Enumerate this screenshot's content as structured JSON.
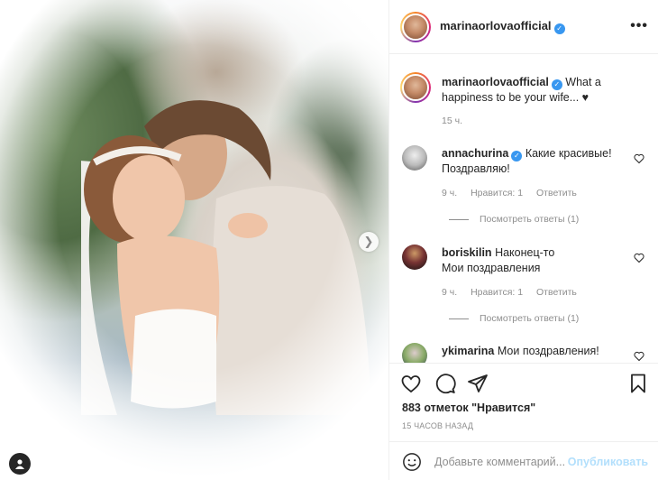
{
  "post": {
    "username": "marinaorlovaofficial",
    "more_label": "•••"
  },
  "caption": {
    "username": "marinaorlovaofficial",
    "text": "What a happiness to be your wife... ♥",
    "time": "15 ч."
  },
  "comments": [
    {
      "username": "annachurina",
      "verified": true,
      "line1": "Какие красивые!",
      "line2": "Поздравляю! ",
      "time": "9 ч.",
      "likes": "Нравится: 1",
      "reply": "Ответить",
      "view_replies": "Посмотреть ответы (1)"
    },
    {
      "username": "boriskilin",
      "verified": false,
      "line1": "Наконец-то ",
      "line2": "Мои поздравления ",
      "time": "9 ч.",
      "likes": "Нравится: 1",
      "reply": "Ответить",
      "view_replies": "Посмотреть ответы (1)"
    },
    {
      "username": "ykimarina",
      "verified": false,
      "line1": "Мои поздравления!",
      "line2": ""
    }
  ],
  "actions": {
    "likes_text": "883 отметок \"Нравится\"",
    "time_ago": "15 ЧАСОВ НАЗАД"
  },
  "add_comment": {
    "placeholder": "Добавьте комментарий...",
    "publish_label": "Опубликовать"
  },
  "colors": {
    "link": "#3897f0",
    "publish_disabled": "#b2dffc",
    "muted": "#8e8e8e"
  }
}
